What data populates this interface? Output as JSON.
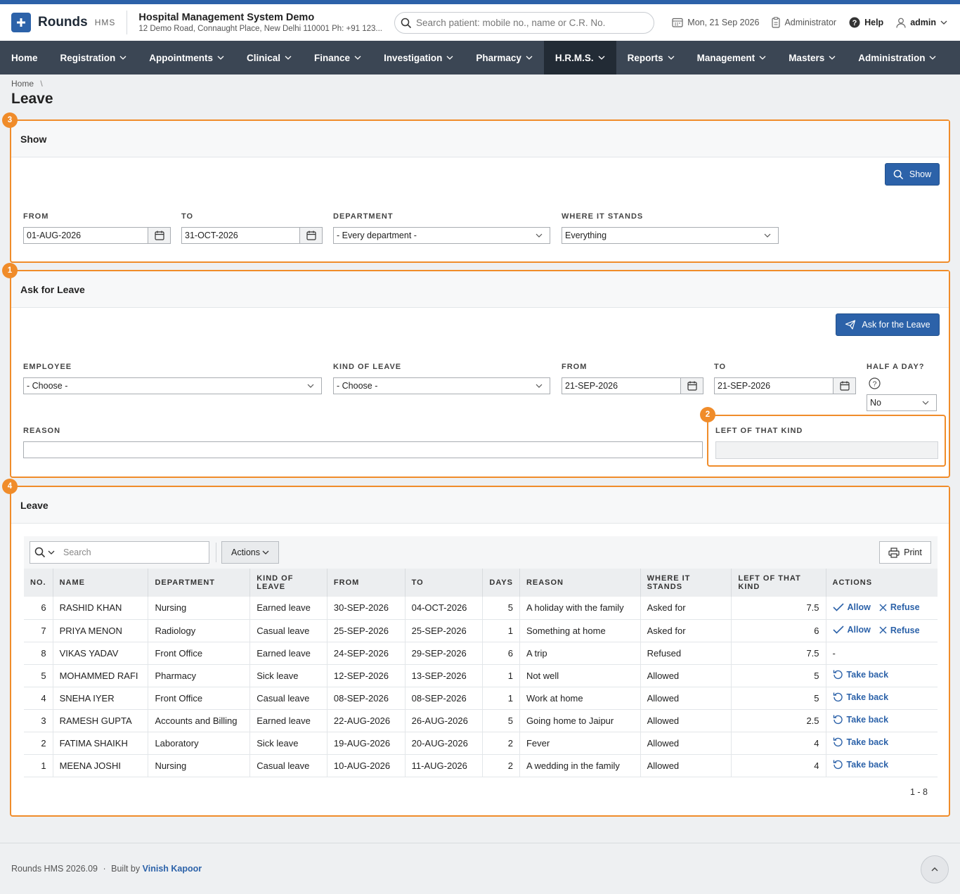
{
  "app": {
    "name": "Rounds",
    "sub": "HMS"
  },
  "hospital": {
    "name": "Hospital Management System Demo",
    "address": "12 Demo Road, Connaught Place, New Delhi 110001 Ph: +91 123..."
  },
  "search": {
    "placeholder": "Search patient: mobile no., name or C.R. No."
  },
  "header": {
    "date": "Mon, 21 Sep 2026",
    "role": "Administrator",
    "help": "Help",
    "user": "admin"
  },
  "nav": [
    {
      "label": "Home"
    },
    {
      "label": "Registration"
    },
    {
      "label": "Appointments"
    },
    {
      "label": "Clinical"
    },
    {
      "label": "Finance"
    },
    {
      "label": "Investigation"
    },
    {
      "label": "Pharmacy"
    },
    {
      "label": "H.R.M.S."
    },
    {
      "label": "Reports"
    },
    {
      "label": "Management"
    },
    {
      "label": "Masters"
    },
    {
      "label": "Administration"
    }
  ],
  "breadcrumb": {
    "home": "Home",
    "sep": "\\"
  },
  "page": {
    "title": "Leave"
  },
  "show_panel": {
    "badge": "3",
    "title": "Show",
    "button": "Show",
    "from_label": "FROM",
    "from_value": "01-AUG-2026",
    "to_label": "TO",
    "to_value": "31-OCT-2026",
    "dept_label": "DEPARTMENT",
    "dept_value": "- Every department -",
    "status_label": "WHERE IT STANDS",
    "status_value": "Everything"
  },
  "ask_panel": {
    "badge": "1",
    "title": "Ask for Leave",
    "button": "Ask for the Leave",
    "employee_label": "EMPLOYEE",
    "employee_value": "- Choose -",
    "kind_label": "KIND OF LEAVE",
    "kind_value": "- Choose -",
    "from_label": "FROM",
    "from_value": "21-SEP-2026",
    "to_label": "TO",
    "to_value": "21-SEP-2026",
    "half_label": "HALF A DAY?",
    "half_value": "No",
    "reason_label": "REASON",
    "reason_value": "",
    "left_badge": "2",
    "left_label": "LEFT OF THAT KIND",
    "left_value": ""
  },
  "leave_panel": {
    "badge": "4",
    "title": "Leave",
    "search_placeholder": "Search",
    "actions_label": "Actions",
    "print_label": "Print",
    "columns": [
      "NO.",
      "NAME",
      "DEPARTMENT",
      "KIND OF LEAVE",
      "FROM",
      "TO",
      "DAYS",
      "REASON",
      "WHERE IT STANDS",
      "LEFT OF THAT KIND",
      "ACTIONS"
    ],
    "rows": [
      {
        "no": "6",
        "name": "RASHID KHAN",
        "dept": "Nursing",
        "kind": "Earned leave",
        "from": "30-SEP-2026",
        "to": "04-OCT-2026",
        "days": "5",
        "reason": "A holiday with the family",
        "status": "Asked for",
        "left": "7.5",
        "action": "pending"
      },
      {
        "no": "7",
        "name": "PRIYA MENON",
        "dept": "Radiology",
        "kind": "Casual leave",
        "from": "25-SEP-2026",
        "to": "25-SEP-2026",
        "days": "1",
        "reason": "Something at home",
        "status": "Asked for",
        "left": "6",
        "action": "pending"
      },
      {
        "no": "8",
        "name": "VIKAS YADAV",
        "dept": "Front Office",
        "kind": "Earned leave",
        "from": "24-SEP-2026",
        "to": "29-SEP-2026",
        "days": "6",
        "reason": "A trip",
        "status": "Refused",
        "left": "7.5",
        "action": "none"
      },
      {
        "no": "5",
        "name": "MOHAMMED RAFI",
        "dept": "Pharmacy",
        "kind": "Sick leave",
        "from": "12-SEP-2026",
        "to": "13-SEP-2026",
        "days": "1",
        "reason": "Not well",
        "status": "Allowed",
        "left": "5",
        "action": "takeback"
      },
      {
        "no": "4",
        "name": "SNEHA IYER",
        "dept": "Front Office",
        "kind": "Casual leave",
        "from": "08-SEP-2026",
        "to": "08-SEP-2026",
        "days": "1",
        "reason": "Work at home",
        "status": "Allowed",
        "left": "5",
        "action": "takeback"
      },
      {
        "no": "3",
        "name": "RAMESH GUPTA",
        "dept": "Accounts and Billing",
        "kind": "Earned leave",
        "from": "22-AUG-2026",
        "to": "26-AUG-2026",
        "days": "5",
        "reason": "Going home to Jaipur",
        "status": "Allowed",
        "left": "2.5",
        "action": "takeback"
      },
      {
        "no": "2",
        "name": "FATIMA SHAIKH",
        "dept": "Laboratory",
        "kind": "Sick leave",
        "from": "19-AUG-2026",
        "to": "20-AUG-2026",
        "days": "2",
        "reason": "Fever",
        "status": "Allowed",
        "left": "4",
        "action": "takeback"
      },
      {
        "no": "1",
        "name": "MEENA JOSHI",
        "dept": "Nursing",
        "kind": "Casual leave",
        "from": "10-AUG-2026",
        "to": "11-AUG-2026",
        "days": "2",
        "reason": "A wedding in the family",
        "status": "Allowed",
        "left": "4",
        "action": "takeback"
      }
    ],
    "action_labels": {
      "allow": "Allow",
      "refuse": "Refuse",
      "takeback": "Take back",
      "none": "-"
    },
    "pager": "1 - 8"
  },
  "footer": {
    "version": "Rounds HMS 2026.09",
    "sep": "·",
    "built": "Built by",
    "author": "Vinish Kapoor"
  }
}
